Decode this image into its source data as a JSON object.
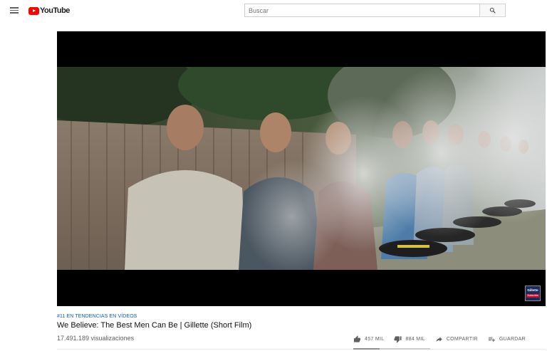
{
  "header": {
    "logo_text": "YouTube",
    "search_placeholder": "Buscar"
  },
  "video": {
    "brand_badge_line1": "Gillette",
    "brand_badge_line2": "Subscribe",
    "hashtag": "#11 EN TENDENCIAS EN VÍDEOS",
    "title": "We Believe: The Best Men Can Be | Gillette (Short Film)",
    "views": "17.491.189 visualizaciones",
    "likes_label": "457 MIL",
    "dislikes_label": "884 MIL",
    "share_label": "COMPARTIR",
    "save_label": "GUARDAR",
    "like_ratio": 0.34
  },
  "icons": {
    "menu": "hamburger-menu-icon",
    "search": "search-icon",
    "like": "thumbs-up-icon",
    "dislike": "thumbs-down-icon",
    "share": "share-arrow-icon",
    "save": "playlist-add-icon"
  },
  "colors": {
    "brand_red": "#ff0000",
    "link_blue": "#065fd4",
    "text_primary": "#111111",
    "text_secondary": "#606060"
  }
}
